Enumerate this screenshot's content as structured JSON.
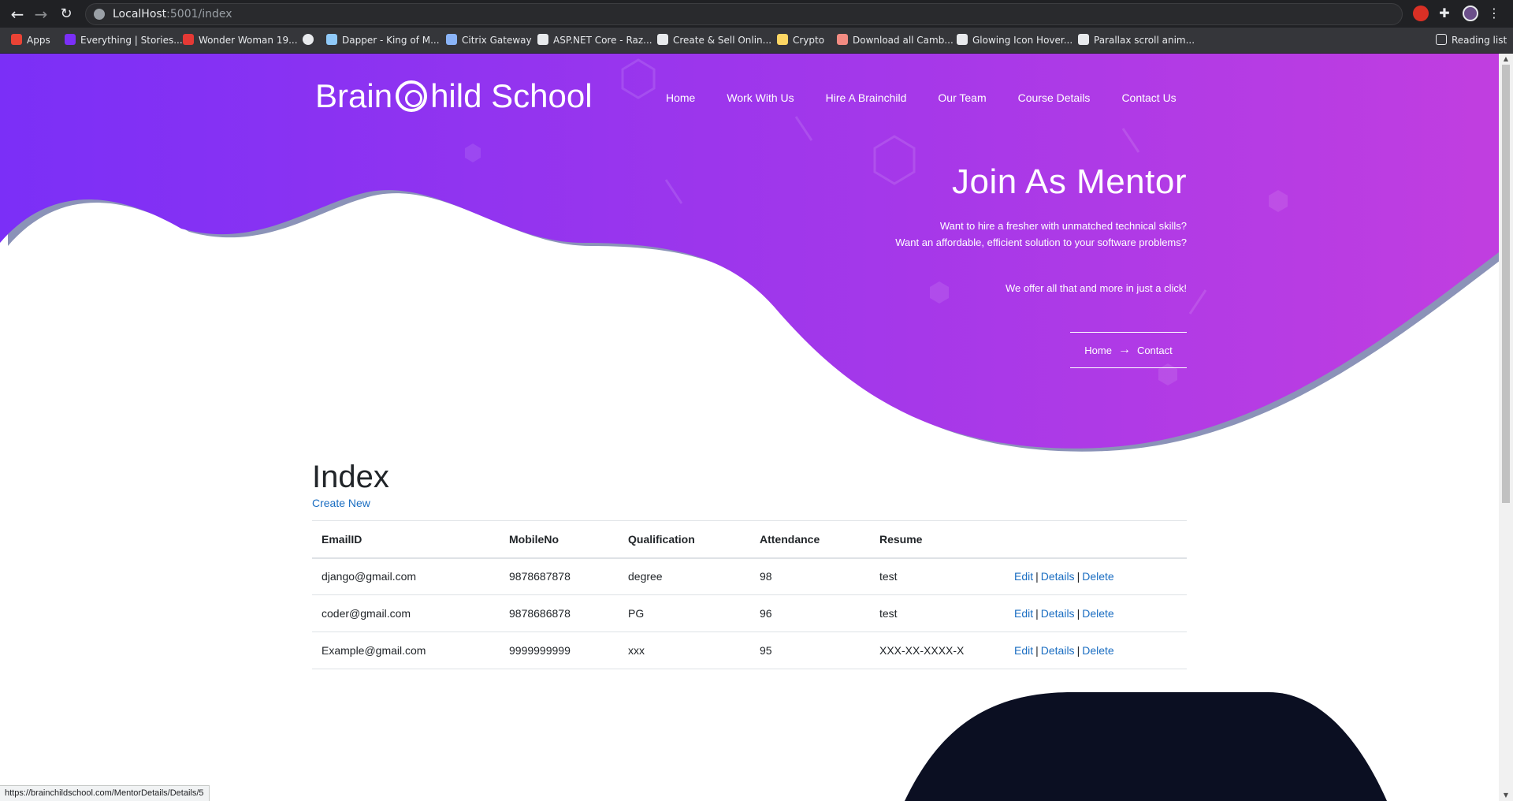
{
  "browser": {
    "url_host": "LocalHost",
    "url_rest": ":5001/index",
    "bookmarks": [
      {
        "label": "Apps",
        "color": "#ea4335"
      },
      {
        "label": "Everything | Stories...",
        "color": "#7b2ff7"
      },
      {
        "label": "Wonder Woman 19...",
        "color": "#e53935"
      },
      {
        "label": "",
        "color": "#e8eaed"
      },
      {
        "label": "Dapper - King of M...",
        "color": "#90caf9"
      },
      {
        "label": "Citrix Gateway",
        "color": "#8ab4f8"
      },
      {
        "label": "ASP.NET Core - Raz...",
        "color": "#e8eaed"
      },
      {
        "label": "Create & Sell Onlin...",
        "color": "#e8eaed"
      },
      {
        "label": "Crypto",
        "color": "#fdd663"
      },
      {
        "label": "Download all Camb...",
        "color": "#f28b82"
      },
      {
        "label": "Glowing Icon Hover...",
        "color": "#e8eaed"
      },
      {
        "label": "Parallax scroll anim...",
        "color": "#e8eaed"
      }
    ],
    "reading_list": "Reading list",
    "status_url": "https://brainchildschool.com/MentorDetails/Details/5"
  },
  "site": {
    "logo_left": "Brain",
    "logo_right": "hild School",
    "nav": [
      "Home",
      "Work With Us",
      "Hire A Brainchild",
      "Our Team",
      "Course Details",
      "Contact Us"
    ],
    "hero": {
      "title": "Join As Mentor",
      "line1": "Want to hire a fresher with unmatched technical skills?",
      "line2": "Want an affordable, efficient solution to your software problems?",
      "tagline": "We offer all that and more in just a click!",
      "crumb_home": "Home",
      "crumb_contact": "Contact"
    },
    "colors": {
      "hero_start": "#7b2ff7",
      "hero_end": "#c13ee0",
      "link": "#1b6ec2",
      "footer_shape": "#0b0f22"
    }
  },
  "index": {
    "title": "Index",
    "create_new": "Create New",
    "columns": [
      "EmailID",
      "MobileNo",
      "Qualification",
      "Attendance",
      "Resume",
      ""
    ],
    "rows": [
      {
        "email": "django@gmail.com",
        "mobile": "9878687878",
        "qualification": "degree",
        "attendance": "98",
        "resume": "test"
      },
      {
        "email": "coder@gmail.com",
        "mobile": "9878686878",
        "qualification": "PG",
        "attendance": "96",
        "resume": "test"
      },
      {
        "email": "Example@gmail.com",
        "mobile": "9999999999",
        "qualification": "xxx",
        "attendance": "95",
        "resume": "XXX-XX-XXXX-X"
      }
    ],
    "actions": {
      "edit": "Edit",
      "details": "Details",
      "delete": "Delete",
      "separator": "|"
    }
  }
}
